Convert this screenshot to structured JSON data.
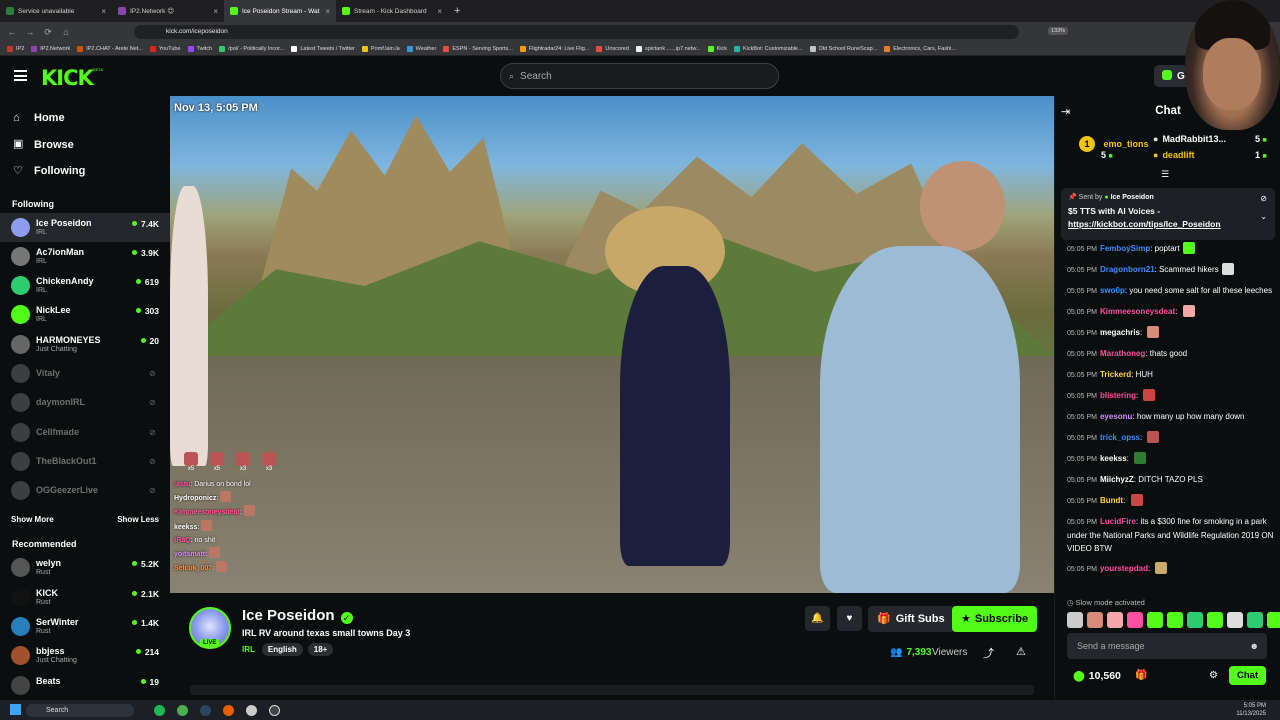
{
  "browser": {
    "tabs": [
      {
        "label": "Service unavailable",
        "color": "#2b7d3b",
        "active": false
      },
      {
        "label": "IP2.Network 😊",
        "color": "#8e44ad",
        "active": false
      },
      {
        "label": "Ice Poseidon Stream - Wat",
        "color": "#53fc18",
        "active": true
      },
      {
        "label": "Stream - Kick Dashboard",
        "color": "#53fc18",
        "active": false
      }
    ],
    "url": "kick.com/iceposeidon",
    "zoom": "133%",
    "bookmarks": [
      {
        "label": "IP2",
        "color": "#c0392b"
      },
      {
        "label": "IP2.Network",
        "color": "#8e44ad"
      },
      {
        "label": "IP2.CHAT - Arete Net...",
        "color": "#d35400"
      },
      {
        "label": "YouTube",
        "color": "#e62117"
      },
      {
        "label": "Twitch",
        "color": "#9146ff"
      },
      {
        "label": "/pol/ - Politically Incor...",
        "color": "#2ecc71"
      },
      {
        "label": "Latest Tweets / Twitter",
        "color": "#ffffff"
      },
      {
        "label": "Pomf.lain.la",
        "color": "#f1c40f"
      },
      {
        "label": "Weather",
        "color": "#3498db"
      },
      {
        "label": "ESPN - Serving Sports...",
        "color": "#e74c3c"
      },
      {
        "label": "Flightradar24: Live Flig...",
        "color": "#f39c12"
      },
      {
        "label": "Unscored",
        "color": "#e74c3c"
      },
      {
        "label": "spictank ......ip7.netw...",
        "color": "#ecf0f1"
      },
      {
        "label": "Kick",
        "color": "#53fc18"
      },
      {
        "label": "KickBot: Customizable...",
        "color": "#1abc9c"
      },
      {
        "label": "Old School RuneScap...",
        "color": "#bdc3c7"
      },
      {
        "label": "Electronics, Cars, Fashi...",
        "color": "#e67e22"
      }
    ]
  },
  "header": {
    "logo": "KICK",
    "logo_badge": "BETA",
    "search_placeholder": "Search",
    "get_button": "Get"
  },
  "sidebar": {
    "nav": [
      {
        "label": "Home",
        "icon": "home-icon"
      },
      {
        "label": "Browse",
        "icon": "browse-icon"
      },
      {
        "label": "Following",
        "icon": "heart-icon"
      }
    ],
    "following_title": "Following",
    "following": [
      {
        "name": "Ice Poseidon",
        "category": "IRL",
        "viewers": "7.4K",
        "live": true,
        "color": "#8e9cf0"
      },
      {
        "name": "Ac7ionMan",
        "category": "IRL",
        "viewers": "3.9K",
        "live": true,
        "color": "#777"
      },
      {
        "name": "ChickenAndy",
        "category": "IRL",
        "viewers": "619",
        "live": true,
        "color": "#2ecc71"
      },
      {
        "name": "NickLee",
        "category": "IRL",
        "viewers": "303",
        "live": true,
        "color": "#53fc18"
      },
      {
        "name": "HARMONEYES",
        "category": "Just Chatting",
        "viewers": "20",
        "live": true,
        "color": "#666"
      },
      {
        "name": "Vitaly",
        "live": false,
        "color": "#888"
      },
      {
        "name": "daymonIRL",
        "live": false,
        "color": "#888"
      },
      {
        "name": "Cellfmade",
        "live": false,
        "color": "#888"
      },
      {
        "name": "TheBlackOut1",
        "live": false,
        "color": "#888"
      },
      {
        "name": "OGGeezerLive",
        "live": false,
        "color": "#888"
      }
    ],
    "show_more": "Show More",
    "show_less": "Show Less",
    "recommended_title": "Recommended",
    "recommended": [
      {
        "name": "welyn",
        "category": "Rust",
        "viewers": "5.2K",
        "color": "#555"
      },
      {
        "name": "KICK",
        "category": "Rust",
        "viewers": "2.1K",
        "color": "#111"
      },
      {
        "name": "SerWinter",
        "category": "Rust",
        "viewers": "1.4K",
        "color": "#2980b9"
      },
      {
        "name": "bbjess",
        "category": "Just Chatting",
        "viewers": "214",
        "color": "#a0522d"
      },
      {
        "name": "Beats",
        "category": "",
        "viewers": "19",
        "color": "#444"
      }
    ]
  },
  "video": {
    "timestamp": "Nov 13, 5:05 PM",
    "emote_counts": [
      "x5",
      "x5",
      "x3",
      "x3"
    ],
    "overlay_chat": [
      {
        "user": "lastu",
        "text": "Darius on bond lol",
        "color": "#ff4fa0"
      },
      {
        "user": "Hydroponicz",
        "text": "",
        "color": "#ffffff"
      },
      {
        "user": "Kimmeesoneysdeat",
        "text": "",
        "color": "#ff4fa0"
      },
      {
        "user": "keekss",
        "text": "",
        "color": "#ffffff"
      },
      {
        "user": "tRaQ",
        "text": "no shit",
        "color": "#ff4fa0"
      },
      {
        "user": "yoitsmatt",
        "text": "",
        "color": "#d58cff"
      },
      {
        "user": "Selcuk_007",
        "text": "",
        "color": "#ff8c3a"
      }
    ]
  },
  "channel": {
    "name": "Ice Poseidon",
    "live_badge": "LIVE",
    "title": "IRL RV around texas small towns Day 3",
    "category": "IRL",
    "tags": [
      "English",
      "18+"
    ],
    "gift_subs": "Gift Subs",
    "subscribe": "Subscribe",
    "viewers": "7,393",
    "viewers_label": "Viewers"
  },
  "chat": {
    "title": "Chat",
    "leaderboard": [
      {
        "rank": "1",
        "name": "emo_tions",
        "value": "5",
        "color": "#f1c40f"
      },
      {
        "name": "MadRabbit13...",
        "value": "5",
        "color": "#ffffff"
      },
      {
        "name": "deadlift",
        "value": "1",
        "color": "#f1c40f"
      }
    ],
    "pinned": {
      "sent_by": "Sent by",
      "sender": "Ice Poseidon",
      "text": "$5 TTS with AI Voices - ",
      "link": "https://kickbot.com/tips/Ice_Poseidon"
    },
    "messages": [
      {
        "time": "05:05 PM",
        "user": "FemboySimp",
        "text": "poptart",
        "color": "#3c8cff",
        "emote": "#53fc18"
      },
      {
        "time": "05:05 PM",
        "user": "Dragonborn21",
        "text": "Scammed hikers",
        "color": "#3c8cff",
        "emote": "#ddd"
      },
      {
        "time": "05:05 PM",
        "user": "swo0p",
        "text": "you need some salt for all these leeches",
        "color": "#3c8cff"
      },
      {
        "time": "05:05 PM",
        "user": "Kimmeesoneysdeat",
        "text": "",
        "color": "#ff4fa0",
        "emote": "#f3a7a7"
      },
      {
        "time": "05:05 PM",
        "user": "megachris",
        "text": "",
        "color": "#ffffff",
        "emote": "#d98b7a"
      },
      {
        "time": "05:05 PM",
        "user": "Marathoneg",
        "text": "thats good",
        "color": "#ff4fa0"
      },
      {
        "time": "05:05 PM",
        "user": "Trickerd",
        "text": "HUH",
        "color": "#ffd23c"
      },
      {
        "time": "05:05 PM",
        "user": "blistering",
        "text": "",
        "color": "#ff4fa0",
        "emote": "#c44"
      },
      {
        "time": "05:05 PM",
        "user": "eyesonu",
        "text": "how many up how many down",
        "color": "#d58cff"
      },
      {
        "time": "05:05 PM",
        "user": "trick_opss",
        "text": "",
        "color": "#3c8cff",
        "emote": "#b55"
      },
      {
        "time": "05:05 PM",
        "user": "keekss",
        "text": "",
        "color": "#ffffff",
        "emote": "#2e7d32"
      },
      {
        "time": "05:05 PM",
        "user": "MiichyzZ",
        "text": "DITCH TAZO PLS",
        "color": "#ffffff"
      },
      {
        "time": "05:05 PM",
        "user": "Bundt",
        "text": "",
        "color": "#ffd23c",
        "emote": "#c44"
      },
      {
        "time": "05:05 PM",
        "user": "LucidFire",
        "text": "its a $300 fine for smoking in a park under the National Parks and Wildlife Regulation 2019 ON VIDEO BTW",
        "color": "#ff4fa0"
      },
      {
        "time": "05:05 PM",
        "user": "yourstepdad",
        "text": "",
        "color": "#ff4fa0",
        "emote": "#c9a96e"
      }
    ],
    "slow_mode": "Slow mode activated",
    "emote_bar": [
      "#ccc",
      "#d98b7a",
      "#f3a7a7",
      "#ff4fa0",
      "#53fc18",
      "#53fc18",
      "#2ecc71",
      "#53fc18",
      "#ddd",
      "#2ecc71",
      "#53fc18"
    ],
    "input_placeholder": "Send a message",
    "points": "10,560",
    "chat_button": "Chat"
  },
  "taskbar": {
    "search": "Search",
    "time": "5:05 PM",
    "date": "11/13/2025"
  }
}
